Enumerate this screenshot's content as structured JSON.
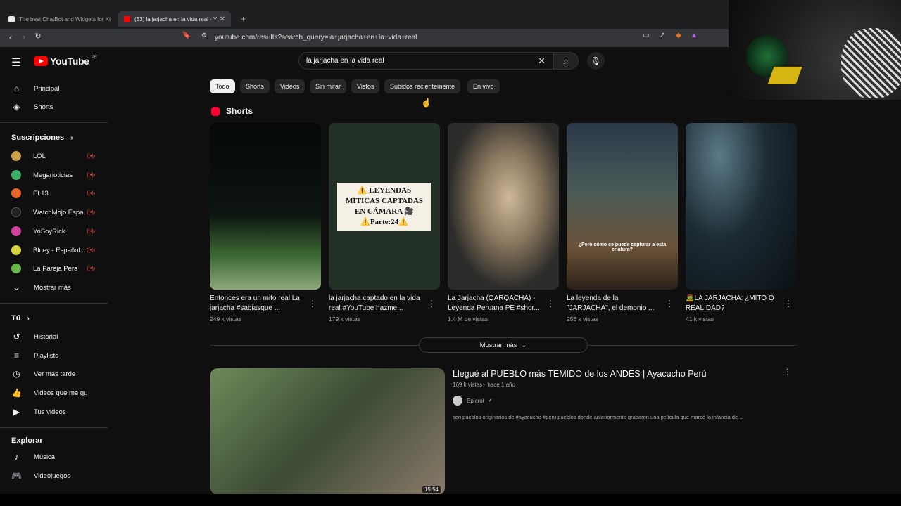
{
  "browser": {
    "tabs": [
      {
        "title": "The best ChatBot and Widgets for Ki"
      },
      {
        "title": "(53) la jarjacha en la vida real - Y"
      }
    ],
    "new_tab": "+",
    "url": "youtube.com/results?search_query=la+jarjacha+en+la+vida+real"
  },
  "header": {
    "logo": "YouTube",
    "region": "PE",
    "search_value": "la jarjacha en la vida real"
  },
  "sidebar": {
    "main": [
      {
        "label": "Principal",
        "icon": "home-icon"
      },
      {
        "label": "Shorts",
        "icon": "shorts-icon"
      }
    ],
    "subs_header": "Suscripciones",
    "subs": [
      {
        "label": "LOL",
        "color": "#c9a14a"
      },
      {
        "label": "Meganoticias",
        "color": "#3fae6b"
      },
      {
        "label": "El 13",
        "color": "#e8662a"
      },
      {
        "label": "WatchMojo Espa...",
        "color": "#222222"
      },
      {
        "label": "YoSoyRick",
        "color": "#d0439b"
      },
      {
        "label": "Bluey - Español ...",
        "color": "#d4d23f"
      },
      {
        "label": "La Pareja Pera",
        "color": "#67b849"
      }
    ],
    "show_more": "Mostrar más",
    "you_header": "Tú",
    "you": [
      {
        "label": "Historial",
        "icon": "history-icon"
      },
      {
        "label": "Playlists",
        "icon": "playlist-icon"
      },
      {
        "label": "Ver más tarde",
        "icon": "clock-icon"
      },
      {
        "label": "Videos que me gus...",
        "icon": "like-icon"
      },
      {
        "label": "Tus videos",
        "icon": "video-icon"
      }
    ],
    "explore_header": "Explorar",
    "explore": [
      {
        "label": "Música",
        "icon": "music-icon"
      },
      {
        "label": "Videojuegos",
        "icon": "gamepad-icon"
      }
    ]
  },
  "chips": [
    "Todo",
    "Shorts",
    "Videos",
    "Sin mirar",
    "Vistos",
    "Subidos recientemente",
    "En vivo"
  ],
  "shorts": {
    "heading": "Shorts",
    "items": [
      {
        "title": "Entonces era un mito real La jarjacha #sabiasque ...",
        "views": "249 k vistas"
      },
      {
        "title": "la jarjacha captado en la vida real #YouTube hazme...",
        "views": "179 k vistas",
        "overlay": "⚠️ LEYENDAS MÍTICAS CAPTADAS EN CÁMARA 🎥 ⚠️Parte:24⚠️"
      },
      {
        "title": "La Jarjacha (QARQACHA) - Leyenda Peruana PE #shor...",
        "views": "1.4 M de vistas"
      },
      {
        "title": "La leyenda de la \"JARJACHA\", el demonio ...",
        "views": "256 k vistas",
        "overlay": "¿Pero cómo se puede capturar a esta criatura?"
      },
      {
        "title": "🧟LA JARJACHA: ¿MITO O REALIDAD?",
        "views": "41 k vistas"
      }
    ],
    "more": "Mostrar más"
  },
  "video": {
    "title": "Llegué al PUEBLO más TEMIDO de los ANDES | Ayacucho Perú",
    "meta": "169 k vistas · hace 1 año",
    "channel": "Epicrol",
    "desc": "son pueblos originarios de #ayacucho #peru pueblos donde anteriormente grabaron una película que marcó la infancia de ...",
    "duration": "15:54"
  }
}
